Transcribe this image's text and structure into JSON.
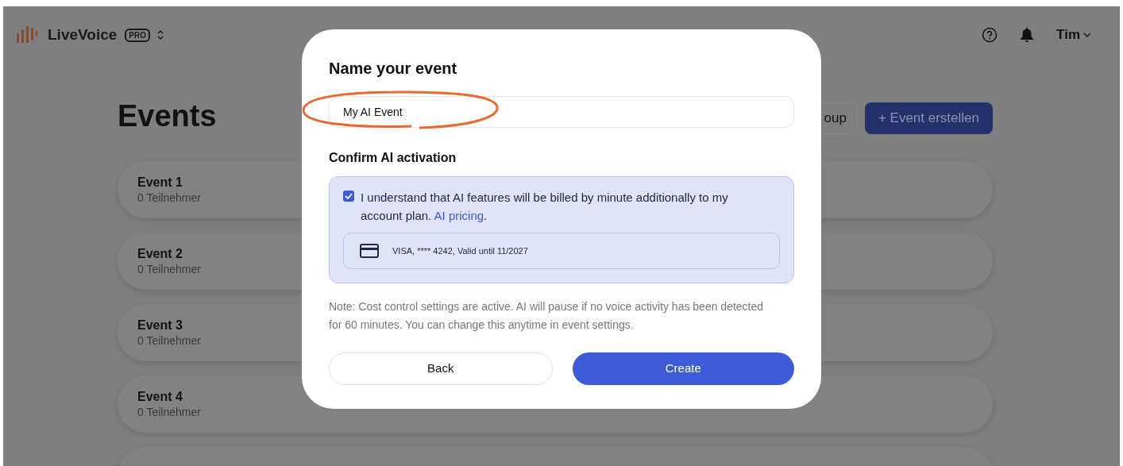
{
  "header": {
    "app_name": "LiveVoice",
    "plan_badge": "PRO",
    "user_menu": "Tim"
  },
  "page": {
    "title": "Events",
    "buttons": [
      {
        "kind": "secondary",
        "label": "oup"
      },
      {
        "kind": "primary",
        "label": "+ Event erstellen"
      }
    ],
    "events": [
      {
        "name": "Event 1",
        "participants": "0 Teilnehmer"
      },
      {
        "name": "Event 2",
        "participants": "0 Teilnehmer"
      },
      {
        "name": "Event 3",
        "participants": "0 Teilnehmer"
      },
      {
        "name": "Event 4",
        "participants": "0 Teilnehmer"
      }
    ]
  },
  "dialog": {
    "title": "Name your event",
    "name_field": {
      "value": "My AI Event",
      "highlighted": true
    },
    "section_title": "Confirm AI activation",
    "consent": {
      "checked": true,
      "text": "I understand that AI features will be billed by minute additionally to my account plan.",
      "link": "AI pricing",
      "after_link": "."
    },
    "payment_method": "VISA, **** 4242, Valid until 11/2027",
    "note": "Note: Cost control settings are active. AI will pause if no voice activity has been detected for 60 minutes. You can change this anytime in event settings.",
    "buttons": [
      {
        "kind": "secondary",
        "label": "Back"
      },
      {
        "kind": "primary",
        "label": "Create"
      }
    ]
  }
}
